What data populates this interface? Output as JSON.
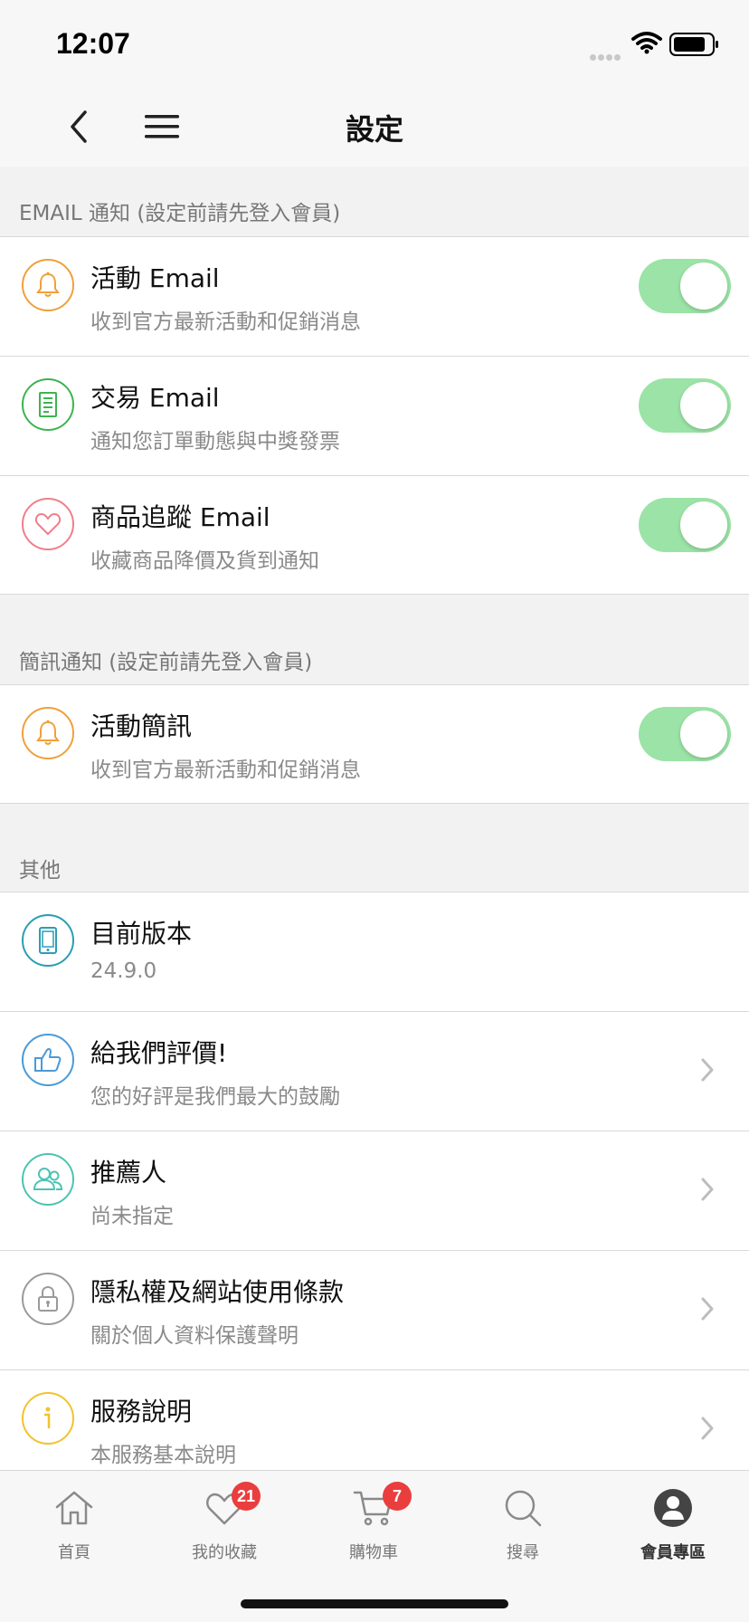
{
  "status_bar": {
    "time": "12:07"
  },
  "nav": {
    "title": "設定"
  },
  "sections": {
    "email": {
      "header": "EMAIL 通知 (設定前請先登入會員)",
      "items": [
        {
          "title": "活動 Email",
          "subtitle": "收到官方最新活動和促銷消息",
          "icon": "bell-icon",
          "color": "#f0a03a",
          "toggle": true
        },
        {
          "title": "交易 Email",
          "subtitle": "通知您訂單動態與中獎發票",
          "icon": "receipt-icon",
          "color": "#3cb450",
          "toggle": true
        },
        {
          "title": "商品追蹤 Email",
          "subtitle": "收藏商品降價及貨到通知",
          "icon": "heart-icon",
          "color": "#ef7f8a",
          "toggle": true
        }
      ]
    },
    "sms": {
      "header": "簡訊通知 (設定前請先登入會員)",
      "items": [
        {
          "title": "活動簡訊",
          "subtitle": "收到官方最新活動和促銷消息",
          "icon": "bell-icon",
          "color": "#f0a03a",
          "toggle": true
        }
      ]
    },
    "other": {
      "header": "其他",
      "items": [
        {
          "title": "目前版本",
          "subtitle": "24.9.0",
          "icon": "tablet-icon",
          "color": "#2a9db5"
        },
        {
          "title": "給我們評價!",
          "subtitle": "您的好評是我們最大的鼓勵",
          "icon": "thumbs-up-icon",
          "color": "#4a9ad8"
        },
        {
          "title": "推薦人",
          "subtitle": "尚未指定",
          "icon": "users-icon",
          "color": "#4cc3b3"
        },
        {
          "title": "隱私權及網站使用條款",
          "subtitle": "關於個人資料保護聲明",
          "icon": "lock-icon",
          "color": "#9a9a9a"
        },
        {
          "title": "服務說明",
          "subtitle": "本服務基本說明",
          "icon": "info-icon",
          "color": "#f2c22e"
        }
      ]
    }
  },
  "toggle_color": "#9be3a6",
  "tabs": [
    {
      "label": "首頁",
      "icon": "home-icon"
    },
    {
      "label": "我的收藏",
      "icon": "heart-icon",
      "badge": "21"
    },
    {
      "label": "購物車",
      "icon": "cart-icon",
      "badge": "7"
    },
    {
      "label": "搜尋",
      "icon": "search-icon"
    },
    {
      "label": "會員專區",
      "icon": "member-icon",
      "active": true
    }
  ]
}
